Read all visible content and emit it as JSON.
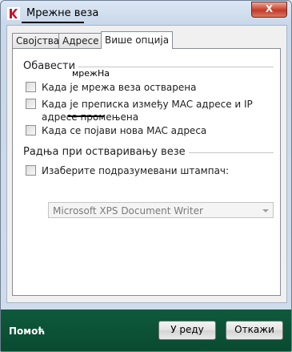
{
  "window": {
    "title": "Мрежне веза",
    "close_label": "X",
    "accent_color": "#0a4a31",
    "close_color": "#c13b2a"
  },
  "tabs": [
    {
      "label": "Својства",
      "active": false
    },
    {
      "label": "Адресе",
      "active": false
    },
    {
      "label": "Више опција",
      "active": true
    }
  ],
  "notifications": {
    "title": "Обавести",
    "floating_label": "мрежНа",
    "items": [
      {
        "label": "Када је мрежа веза остварена",
        "checked": false
      },
      {
        "label": "Када је преписка између MAC адресе и IP адресе промењена",
        "checked": false
      },
      {
        "label": "Када се појави нова MAC адреса",
        "checked": false
      }
    ]
  },
  "connect_action": {
    "title": "Радња при остваривању везе",
    "checkbox_label": "Изаберите подразумевани штампач:",
    "checked": false,
    "printer_value": "Microsoft XPS Document Writer",
    "printer_enabled": false
  },
  "footer": {
    "help_label": "Помоћ",
    "ok_label": "У реду",
    "cancel_label": "Откажи"
  }
}
